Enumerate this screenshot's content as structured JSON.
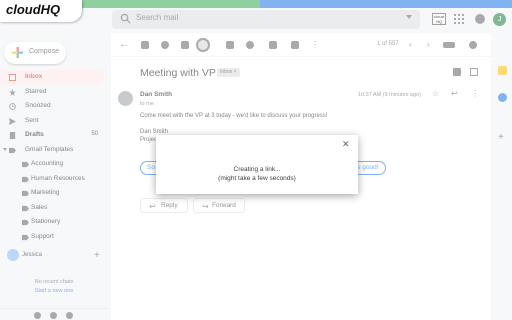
{
  "brand": {
    "logo_text": "cloudHQ"
  },
  "header": {
    "search_placeholder": "Search mail",
    "cloudhq_badge": "cloud HQ",
    "avatar_initial": "J"
  },
  "sidebar": {
    "compose_label": "Compose",
    "items": [
      {
        "label": "Inbox",
        "count": ""
      },
      {
        "label": "Starred",
        "count": ""
      },
      {
        "label": "Snoozed",
        "count": ""
      },
      {
        "label": "Sent",
        "count": ""
      },
      {
        "label": "Drafts",
        "count": "50"
      },
      {
        "label": "Gmail Templates",
        "count": ""
      },
      {
        "label": "Accounting",
        "count": ""
      },
      {
        "label": "Human Resources",
        "count": ""
      },
      {
        "label": "Marketing",
        "count": ""
      },
      {
        "label": "Sales",
        "count": ""
      },
      {
        "label": "Stationery",
        "count": ""
      },
      {
        "label": "Support",
        "count": ""
      }
    ],
    "hangouts": {
      "user_name": "Jessica",
      "no_chats": "No recent chats",
      "start_new": "Start a new one"
    }
  },
  "toolbar": {
    "pager": "1 of 557"
  },
  "email": {
    "subject": "Meeting with VP",
    "label_tag": "Inbox ×",
    "sender": "Dan Smith",
    "to": "to me",
    "date": "10:37 AM (9 minutes ago)",
    "body_line1": "Come meet with the VP at 3 today - we'd like to discuss your progress!",
    "body_line2": "Dan Smith",
    "body_line3": "Project"
  },
  "smart_replies": {
    "left": "So",
    "right": "nds good!"
  },
  "actions": {
    "reply": "Reply",
    "forward": "Forward"
  },
  "dialog": {
    "message": "Creating a link...",
    "submessage": "(might take a few seconds)"
  },
  "colors": {
    "inbox_accent": "#d93025",
    "link": "#1a73e8",
    "brand_green": "#34a853",
    "brand_blue": "#1a73e8"
  }
}
